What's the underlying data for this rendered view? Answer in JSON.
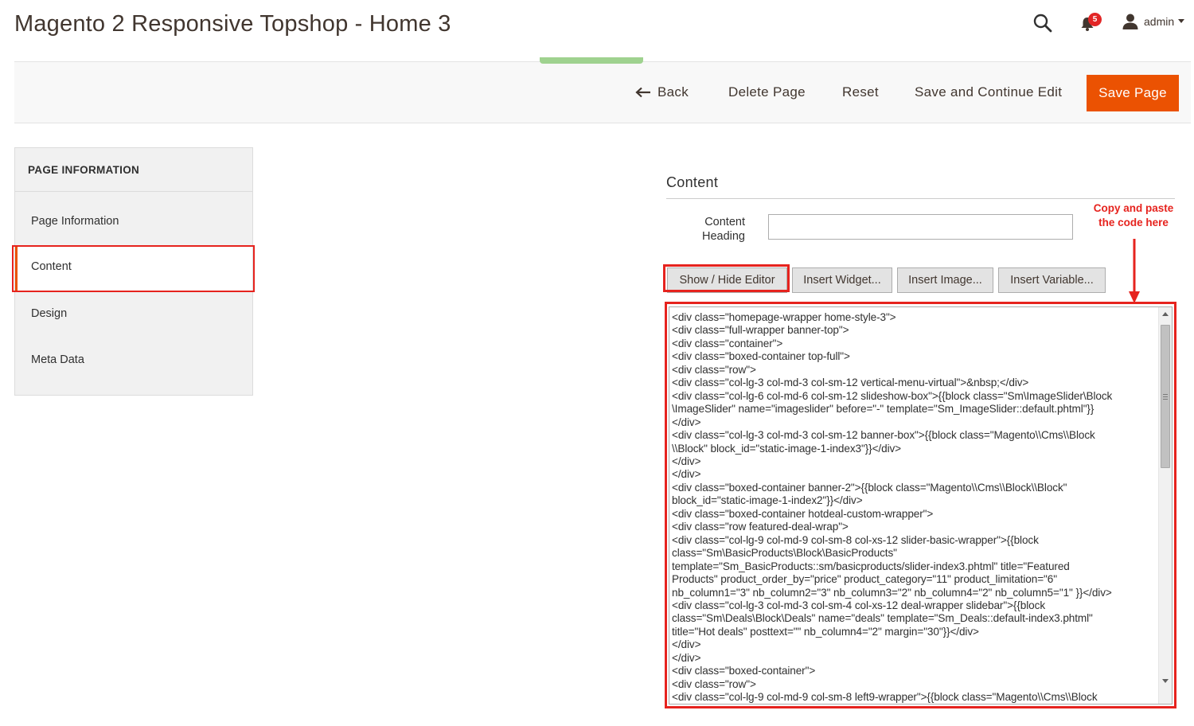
{
  "header": {
    "title": "Magento 2 Responsive Topshop - Home 3",
    "notification_count": "5",
    "user_name": "admin",
    "icons": [
      "search-icon",
      "bell-icon",
      "user-icon",
      "chevron-down-icon"
    ]
  },
  "actions": {
    "back": "Back",
    "delete": "Delete Page",
    "reset": "Reset",
    "save_continue": "Save and Continue Edit",
    "save": "Save Page"
  },
  "sidebar": {
    "title": "PAGE INFORMATION",
    "items": [
      "Page Information",
      "Content",
      "Design",
      "Meta Data"
    ],
    "active": "Content"
  },
  "content": {
    "section_title": "Content",
    "heading_label": "Content Heading",
    "heading_value": "",
    "annotation": "Copy and paste the code here",
    "buttons": {
      "show_hide": "Show / Hide Editor",
      "widget": "Insert Widget...",
      "image": "Insert Image...",
      "variable": "Insert Variable..."
    },
    "code_lines": [
      "<div class=\"homepage-wrapper home-style-3\">",
      "<div class=\"full-wrapper banner-top\">",
      "<div class=\"container\">",
      "<div class=\"boxed-container top-full\">",
      "<div class=\"row\">",
      "<div class=\"col-lg-3 col-md-3 col-sm-12 vertical-menu-virtual\">&nbsp;</div>",
      "<div class=\"col-lg-6 col-md-6 col-sm-12 slideshow-box\">{{block class=\"Sm\\ImageSlider\\Block",
      "\\ImageSlider\" name=\"imageslider\" before=\"-\" template=\"Sm_ImageSlider::default.phtml\"}}",
      "</div>",
      "<div class=\"col-lg-3 col-md-3 col-sm-12 banner-box\">{{block class=\"Magento\\\\Cms\\\\Block",
      "\\\\Block\" block_id=\"static-image-1-index3\"}}</div>",
      "</div>",
      "</div>",
      "<div class=\"boxed-container banner-2\">{{block class=\"Magento\\\\Cms\\\\Block\\\\Block\"",
      "block_id=\"static-image-1-index2\"}}</div>",
      "<div class=\"boxed-container hotdeal-custom-wrapper\">",
      "<div class=\"row featured-deal-wrap\">",
      "<div class=\"col-lg-9 col-md-9 col-sm-8 col-xs-12 slider-basic-wrapper\">{{block",
      "class=\"Sm\\BasicProducts\\Block\\BasicProducts\"",
      "template=\"Sm_BasicProducts::sm/basicproducts/slider-index3.phtml\" title=\"Featured",
      "Products\" product_order_by=\"price\" product_category=\"11\" product_limitation=\"6\"",
      "nb_column1=\"3\" nb_column2=\"3\" nb_column3=\"2\" nb_column4=\"2\" nb_column5=\"1\" }}</div>",
      "<div class=\"col-lg-3 col-md-3 col-sm-4 col-xs-12 deal-wrapper slidebar\">{{block",
      "class=\"Sm\\Deals\\Block\\Deals\" name=\"deals\" template=\"Sm_Deals::default-index3.phtml\"",
      "title=\"Hot deals\" posttext=\"\" nb_column4=\"2\" margin=\"30\"}}</div>",
      "</div>",
      "</div>",
      "<div class=\"boxed-container\">",
      "<div class=\"row\">",
      "<div class=\"col-lg-9 col-md-9 col-sm-8 left9-wrapper\">{{block class=\"Magento\\\\Cms\\\\Block"
    ]
  },
  "colors": {
    "primary_button": "#eb5202",
    "annotation_red": "#e6231e",
    "sidebar_bg": "#f1f1f1",
    "action_bar_bg": "#f8f8f8"
  }
}
